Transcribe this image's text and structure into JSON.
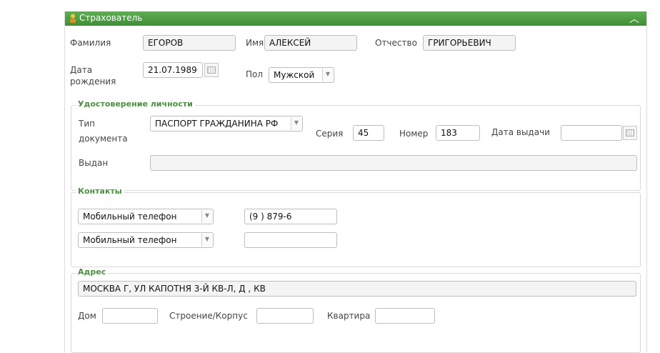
{
  "panel": {
    "title": "Страхователь",
    "collapse_icon": "chevron-up-icon"
  },
  "person": {
    "last_name_label": "Фамилия",
    "last_name": "ЕГОРОВ",
    "first_name_label": "Имя",
    "first_name": "АЛЕКСЕЙ",
    "patronymic_label": "Отчество",
    "patronymic": "ГРИГОРЬЕВИЧ",
    "birth_label_1": "Дата",
    "birth_label_2": "рождения",
    "birth_date": "21.07.1989",
    "gender_label": "Пол",
    "gender": "Мужской"
  },
  "identity": {
    "legend": "Удостоверение личности",
    "type_label_1": "Тип",
    "type_label_2": "документа",
    "type": "ПАСПОРТ ГРАЖДАНИНА РФ",
    "series_label": "Серия",
    "series": "45",
    "number_label": "Номер",
    "number": "183",
    "issue_date_label": "Дата выдачи",
    "issue_date": "",
    "issued_by_label": "Выдан",
    "issued_by": ""
  },
  "contacts": {
    "legend": "Контакты",
    "rows": [
      {
        "type": "Мобильный телефон",
        "value": "(9     ) 879-6"
      },
      {
        "type": "Мобильный телефон",
        "value": ""
      }
    ]
  },
  "address": {
    "legend": "Адрес",
    "full": "МОСКВА Г,  УЛ  КАПОТНЯ 3-Й КВ-Л,  Д       ,  КВ",
    "house_label": "Дом",
    "house": "",
    "building_label": "Строение/Корпус",
    "building": "",
    "apartment_label": "Квартира",
    "apartment": ""
  }
}
